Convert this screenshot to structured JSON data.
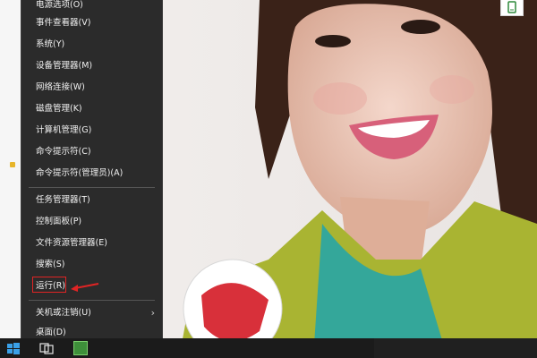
{
  "menu": {
    "items": [
      {
        "label": "电源选项(O)"
      },
      {
        "label": "事件查看器(V)"
      },
      {
        "label": "系统(Y)"
      },
      {
        "label": "设备管理器(M)"
      },
      {
        "label": "网络连接(W)"
      },
      {
        "label": "磁盘管理(K)"
      },
      {
        "label": "计算机管理(G)"
      },
      {
        "label": "命令提示符(C)"
      },
      {
        "label": "命令提示符(管理员)(A)"
      },
      {
        "label": "任务管理器(T)"
      },
      {
        "label": "控制面板(P)"
      },
      {
        "label": "文件资源管理器(E)"
      },
      {
        "label": "搜索(S)"
      },
      {
        "label": "运行(R)"
      },
      {
        "label": "关机或注销(U)",
        "chevron": "›"
      },
      {
        "label": "桌面(D)"
      }
    ]
  },
  "annotation": {
    "highlighted_item": "运行(R)",
    "color": "#e02424"
  },
  "colors": {
    "menu_bg": "#2b2b2b",
    "menu_text": "#f2f2f2",
    "taskbar_bg": "#1b1b1b"
  },
  "icons": {
    "start": "windows-start-icon",
    "taskview": "task-view-icon",
    "app": "green-app-icon",
    "top_right": "tablet-mode-icon"
  }
}
